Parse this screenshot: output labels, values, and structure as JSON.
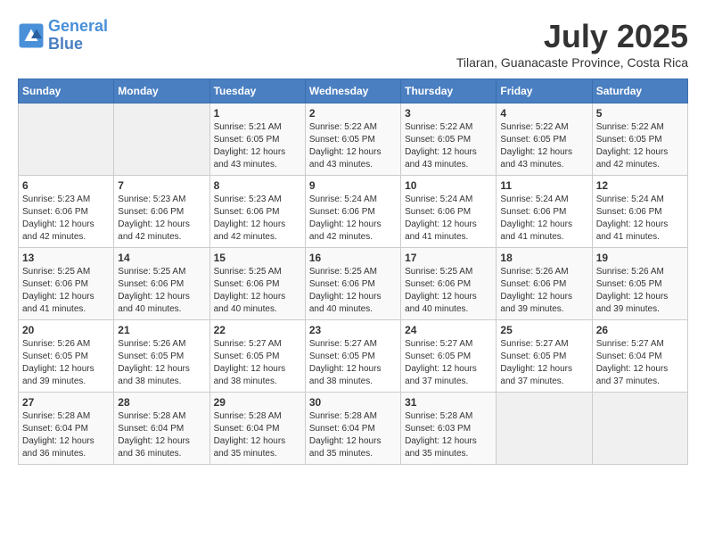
{
  "header": {
    "logo_line1": "General",
    "logo_line2": "Blue",
    "title": "July 2025",
    "location": "Tilaran, Guanacaste Province, Costa Rica"
  },
  "weekdays": [
    "Sunday",
    "Monday",
    "Tuesday",
    "Wednesday",
    "Thursday",
    "Friday",
    "Saturday"
  ],
  "weeks": [
    [
      {
        "day": "",
        "sunrise": "",
        "sunset": "",
        "daylight": ""
      },
      {
        "day": "",
        "sunrise": "",
        "sunset": "",
        "daylight": ""
      },
      {
        "day": "1",
        "sunrise": "Sunrise: 5:21 AM",
        "sunset": "Sunset: 6:05 PM",
        "daylight": "Daylight: 12 hours and 43 minutes."
      },
      {
        "day": "2",
        "sunrise": "Sunrise: 5:22 AM",
        "sunset": "Sunset: 6:05 PM",
        "daylight": "Daylight: 12 hours and 43 minutes."
      },
      {
        "day": "3",
        "sunrise": "Sunrise: 5:22 AM",
        "sunset": "Sunset: 6:05 PM",
        "daylight": "Daylight: 12 hours and 43 minutes."
      },
      {
        "day": "4",
        "sunrise": "Sunrise: 5:22 AM",
        "sunset": "Sunset: 6:05 PM",
        "daylight": "Daylight: 12 hours and 43 minutes."
      },
      {
        "day": "5",
        "sunrise": "Sunrise: 5:22 AM",
        "sunset": "Sunset: 6:05 PM",
        "daylight": "Daylight: 12 hours and 42 minutes."
      }
    ],
    [
      {
        "day": "6",
        "sunrise": "Sunrise: 5:23 AM",
        "sunset": "Sunset: 6:06 PM",
        "daylight": "Daylight: 12 hours and 42 minutes."
      },
      {
        "day": "7",
        "sunrise": "Sunrise: 5:23 AM",
        "sunset": "Sunset: 6:06 PM",
        "daylight": "Daylight: 12 hours and 42 minutes."
      },
      {
        "day": "8",
        "sunrise": "Sunrise: 5:23 AM",
        "sunset": "Sunset: 6:06 PM",
        "daylight": "Daylight: 12 hours and 42 minutes."
      },
      {
        "day": "9",
        "sunrise": "Sunrise: 5:24 AM",
        "sunset": "Sunset: 6:06 PM",
        "daylight": "Daylight: 12 hours and 42 minutes."
      },
      {
        "day": "10",
        "sunrise": "Sunrise: 5:24 AM",
        "sunset": "Sunset: 6:06 PM",
        "daylight": "Daylight: 12 hours and 41 minutes."
      },
      {
        "day": "11",
        "sunrise": "Sunrise: 5:24 AM",
        "sunset": "Sunset: 6:06 PM",
        "daylight": "Daylight: 12 hours and 41 minutes."
      },
      {
        "day": "12",
        "sunrise": "Sunrise: 5:24 AM",
        "sunset": "Sunset: 6:06 PM",
        "daylight": "Daylight: 12 hours and 41 minutes."
      }
    ],
    [
      {
        "day": "13",
        "sunrise": "Sunrise: 5:25 AM",
        "sunset": "Sunset: 6:06 PM",
        "daylight": "Daylight: 12 hours and 41 minutes."
      },
      {
        "day": "14",
        "sunrise": "Sunrise: 5:25 AM",
        "sunset": "Sunset: 6:06 PM",
        "daylight": "Daylight: 12 hours and 40 minutes."
      },
      {
        "day": "15",
        "sunrise": "Sunrise: 5:25 AM",
        "sunset": "Sunset: 6:06 PM",
        "daylight": "Daylight: 12 hours and 40 minutes."
      },
      {
        "day": "16",
        "sunrise": "Sunrise: 5:25 AM",
        "sunset": "Sunset: 6:06 PM",
        "daylight": "Daylight: 12 hours and 40 minutes."
      },
      {
        "day": "17",
        "sunrise": "Sunrise: 5:25 AM",
        "sunset": "Sunset: 6:06 PM",
        "daylight": "Daylight: 12 hours and 40 minutes."
      },
      {
        "day": "18",
        "sunrise": "Sunrise: 5:26 AM",
        "sunset": "Sunset: 6:06 PM",
        "daylight": "Daylight: 12 hours and 39 minutes."
      },
      {
        "day": "19",
        "sunrise": "Sunrise: 5:26 AM",
        "sunset": "Sunset: 6:05 PM",
        "daylight": "Daylight: 12 hours and 39 minutes."
      }
    ],
    [
      {
        "day": "20",
        "sunrise": "Sunrise: 5:26 AM",
        "sunset": "Sunset: 6:05 PM",
        "daylight": "Daylight: 12 hours and 39 minutes."
      },
      {
        "day": "21",
        "sunrise": "Sunrise: 5:26 AM",
        "sunset": "Sunset: 6:05 PM",
        "daylight": "Daylight: 12 hours and 38 minutes."
      },
      {
        "day": "22",
        "sunrise": "Sunrise: 5:27 AM",
        "sunset": "Sunset: 6:05 PM",
        "daylight": "Daylight: 12 hours and 38 minutes."
      },
      {
        "day": "23",
        "sunrise": "Sunrise: 5:27 AM",
        "sunset": "Sunset: 6:05 PM",
        "daylight": "Daylight: 12 hours and 38 minutes."
      },
      {
        "day": "24",
        "sunrise": "Sunrise: 5:27 AM",
        "sunset": "Sunset: 6:05 PM",
        "daylight": "Daylight: 12 hours and 37 minutes."
      },
      {
        "day": "25",
        "sunrise": "Sunrise: 5:27 AM",
        "sunset": "Sunset: 6:05 PM",
        "daylight": "Daylight: 12 hours and 37 minutes."
      },
      {
        "day": "26",
        "sunrise": "Sunrise: 5:27 AM",
        "sunset": "Sunset: 6:04 PM",
        "daylight": "Daylight: 12 hours and 37 minutes."
      }
    ],
    [
      {
        "day": "27",
        "sunrise": "Sunrise: 5:28 AM",
        "sunset": "Sunset: 6:04 PM",
        "daylight": "Daylight: 12 hours and 36 minutes."
      },
      {
        "day": "28",
        "sunrise": "Sunrise: 5:28 AM",
        "sunset": "Sunset: 6:04 PM",
        "daylight": "Daylight: 12 hours and 36 minutes."
      },
      {
        "day": "29",
        "sunrise": "Sunrise: 5:28 AM",
        "sunset": "Sunset: 6:04 PM",
        "daylight": "Daylight: 12 hours and 35 minutes."
      },
      {
        "day": "30",
        "sunrise": "Sunrise: 5:28 AM",
        "sunset": "Sunset: 6:04 PM",
        "daylight": "Daylight: 12 hours and 35 minutes."
      },
      {
        "day": "31",
        "sunrise": "Sunrise: 5:28 AM",
        "sunset": "Sunset: 6:03 PM",
        "daylight": "Daylight: 12 hours and 35 minutes."
      },
      {
        "day": "",
        "sunrise": "",
        "sunset": "",
        "daylight": ""
      },
      {
        "day": "",
        "sunrise": "",
        "sunset": "",
        "daylight": ""
      }
    ]
  ]
}
